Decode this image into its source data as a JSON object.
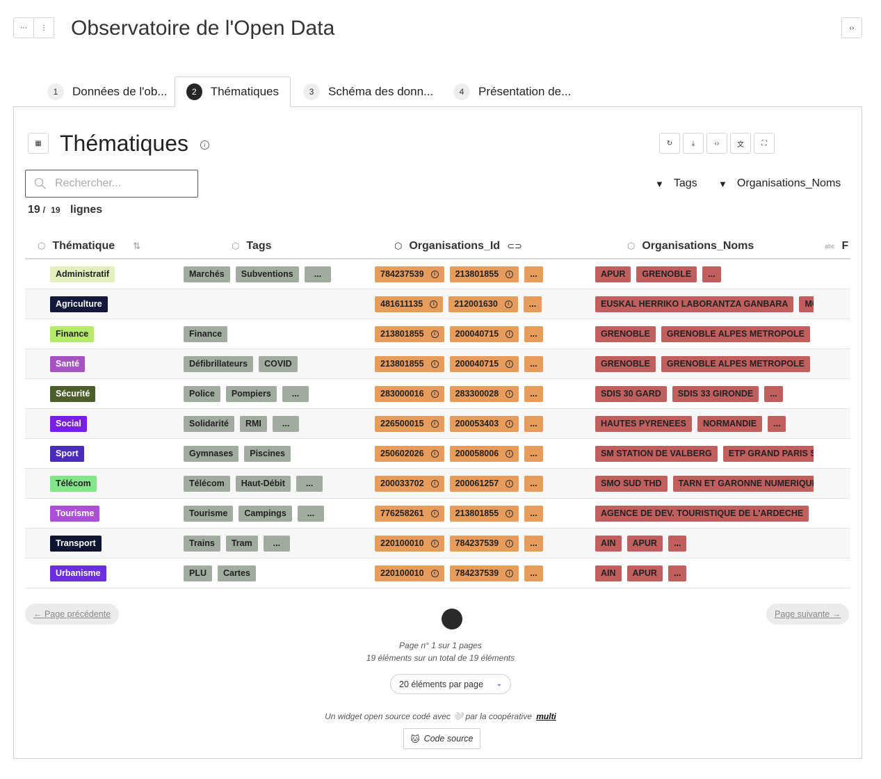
{
  "app": {
    "title": "Observatoire de l'Open Data",
    "tabs": [
      {
        "num": "1",
        "label": "Données de l'ob..."
      },
      {
        "num": "2",
        "label": "Thématiques"
      },
      {
        "num": "3",
        "label": "Schéma des donn..."
      },
      {
        "num": "4",
        "label": "Présentation de..."
      }
    ],
    "active_tab": "2"
  },
  "widget": {
    "title": "Thématiques",
    "search_placeholder": "Rechercher...",
    "filters": [
      "Tags",
      "Organisations_Noms"
    ],
    "count": {
      "shown": "19",
      "total": "19",
      "unit": "lignes"
    },
    "toolbar_icons": [
      "refresh-icon",
      "download-icon",
      "code-icon",
      "translate-icon",
      "fullscreen-icon"
    ]
  },
  "table": {
    "columns": [
      "Thématique",
      "Tags",
      "Organisations_Id",
      "Organisations_Noms",
      "F"
    ],
    "rows": [
      {
        "theme": "Administratif",
        "color": "#e3efbd",
        "fg": "#222222",
        "tags": [
          "Marchés",
          "Subventions",
          "..."
        ],
        "ids": [
          "784237539",
          "213801855",
          "..."
        ],
        "noms": [
          "APUR",
          "GRENOBLE",
          "..."
        ]
      },
      {
        "theme": "Agriculture",
        "color": "#14183a",
        "fg": "#ffffff",
        "tags": [],
        "ids": [
          "481611135",
          "212001630",
          "..."
        ],
        "noms": [
          "EUSKAL HERRIKO LABORANTZA GANBARA",
          "MO"
        ]
      },
      {
        "theme": "Finance",
        "color": "#b5ea6d",
        "fg": "#222222",
        "tags": [
          "Finance"
        ],
        "ids": [
          "213801855",
          "200040715",
          "..."
        ],
        "noms": [
          "GRENOBLE",
          "GRENOBLE ALPES METROPOLE",
          ""
        ]
      },
      {
        "theme": "Santé",
        "color": "#a653c2",
        "fg": "#ffffff",
        "tags": [
          "Défibrillateurs",
          "COVID"
        ],
        "ids": [
          "213801855",
          "200040715",
          "..."
        ],
        "noms": [
          "GRENOBLE",
          "GRENOBLE ALPES METROPOLE",
          ""
        ]
      },
      {
        "theme": "Sécurité",
        "color": "#4c5f2a",
        "fg": "#ffffff",
        "tags": [
          "Police",
          "Pompiers",
          "..."
        ],
        "ids": [
          "283000016",
          "283300028",
          "..."
        ],
        "noms": [
          "SDIS 30 GARD",
          "SDIS 33 GIRONDE",
          "..."
        ]
      },
      {
        "theme": "Social",
        "color": "#7a1fe0",
        "fg": "#ffffff",
        "tags": [
          "Solidarité",
          "RMI",
          "..."
        ],
        "ids": [
          "226500015",
          "200053403",
          "..."
        ],
        "noms": [
          "HAUTES PYRENEES",
          "NORMANDIE",
          "..."
        ]
      },
      {
        "theme": "Sport",
        "color": "#4a2cbb",
        "fg": "#ffffff",
        "tags": [
          "Gymnases",
          "Piscines"
        ],
        "ids": [
          "250602026",
          "200058006",
          "..."
        ],
        "noms": [
          "SM STATION DE VALBERG",
          "ETP GRAND PARIS S"
        ]
      },
      {
        "theme": "Télécom",
        "color": "#83e68a",
        "fg": "#222222",
        "tags": [
          "Télécom",
          "Haut-Débit",
          "..."
        ],
        "ids": [
          "200033702",
          "200061257",
          "..."
        ],
        "noms": [
          "SMO SUD THD",
          "TARN ET GARONNE NUMERIQUE"
        ]
      },
      {
        "theme": "Tourisme",
        "color": "#aa4fd6",
        "fg": "#ffffff",
        "tags": [
          "Tourisme",
          "Campings",
          "..."
        ],
        "ids": [
          "776258261",
          "213801855",
          "..."
        ],
        "noms": [
          "AGENCE DE DEV. TOURISTIQUE DE L'ARDECHE",
          ""
        ]
      },
      {
        "theme": "Transport",
        "color": "#0f1530",
        "fg": "#ffffff",
        "tags": [
          "Trains",
          "Tram",
          "..."
        ],
        "ids": [
          "220100010",
          "784237539",
          "..."
        ],
        "noms": [
          "AIN",
          "APUR",
          "..."
        ]
      },
      {
        "theme": "Urbanisme",
        "color": "#6b2ee0",
        "fg": "#ffffff",
        "tags": [
          "PLU",
          "Cartes"
        ],
        "ids": [
          "220100010",
          "784237539",
          "..."
        ],
        "noms": [
          "AIN",
          "APUR",
          "..."
        ]
      }
    ]
  },
  "pagination": {
    "prev": "← Page précédente",
    "next": "Page suivante →",
    "current": "1",
    "page_info": "Page n° 1 sur 1 pages",
    "items_info": "19 éléments sur un total de 19 éléments",
    "per_page": "20 éléments par page"
  },
  "footer": {
    "credit_prefix": "Un widget open source codé avec 🤍 par la coopérative",
    "credit_link": "multi",
    "source_button": "Code source"
  }
}
